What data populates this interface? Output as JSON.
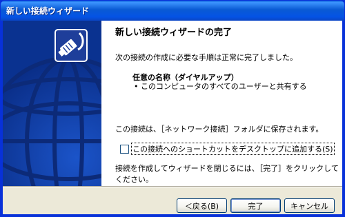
{
  "window": {
    "title": "新しい接続ウィザード"
  },
  "main": {
    "heading": "新しい接続ウィザードの完了",
    "intro": "次の接続の作成に必要な手順は正常に完了しました。",
    "connection_name": "任意の名称（ダイヤルアップ）",
    "bullet_item": "このコンピュータのすべてのユーザーと共有する",
    "saved_note": "この接続は、［ネットワーク接続］フォルダに保存されます。",
    "shortcut_checkbox_label": "この接続へのショートカットをデスクトップに追加する(S)",
    "shortcut_checked": false,
    "finish_hint": "接続を作成してウィザードを閉じるには、［完了］をクリックしてください。"
  },
  "buttons": {
    "back": "＜戻る(B)",
    "finish": "完了",
    "cancel": "キャンセル"
  },
  "colors": {
    "title_bar": "#0a5ad4",
    "banner": "#0a3290",
    "dialog_face": "#ece9d8"
  },
  "icons": {
    "banner_icon": "network-plug-icon"
  }
}
